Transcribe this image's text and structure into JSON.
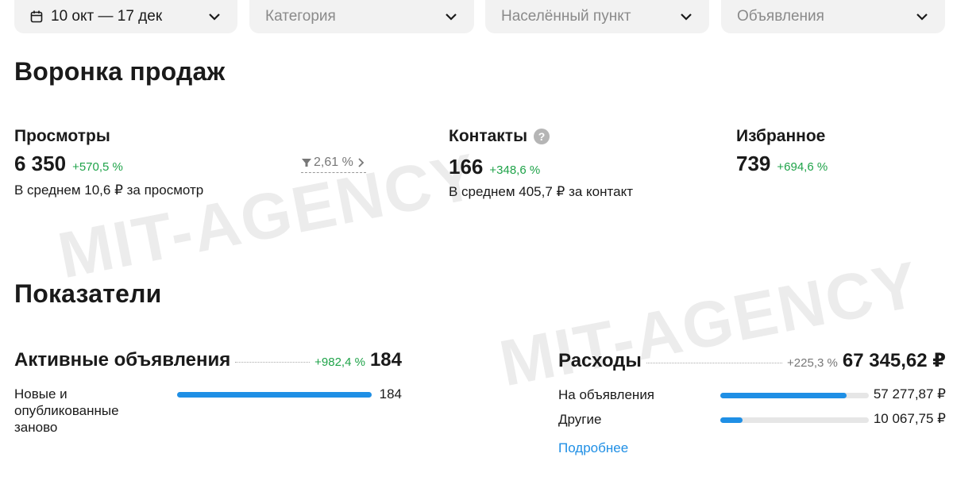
{
  "filters": {
    "period": "10 окт — 17 дек",
    "category": "Категория",
    "locality": "Населённый пункт",
    "ads": "Объявления"
  },
  "funnel": {
    "title": "Воронка продаж",
    "views": {
      "label": "Просмотры",
      "value": "6 350",
      "change": "+570,5 %",
      "sub": "В среднем 10,6 ₽ за просмотр",
      "conversion": "2,61 %"
    },
    "contacts": {
      "label": "Контакты",
      "help": "?",
      "value": "166",
      "change": "+348,6 %",
      "sub": "В среднем 405,7 ₽ за контакт"
    },
    "favorites": {
      "label": "Избранное",
      "value": "739",
      "change": "+694,6 %"
    }
  },
  "indicators": {
    "title": "Показатели",
    "active_ads": {
      "label": "Активные объявления",
      "change": "+982,4 %",
      "value": "184",
      "rows": [
        {
          "label": "Новые и опубликованные заново",
          "value": "184",
          "fraction": 1.0
        }
      ]
    },
    "expenses": {
      "label": "Расходы",
      "change": "+225,3 %",
      "value": "67 345,62 ₽",
      "rows": [
        {
          "label": "На объявления",
          "value": "57 277,87 ₽",
          "fraction": 0.85
        },
        {
          "label": "Другие",
          "value": "10 067,75 ₽",
          "fraction": 0.15
        }
      ],
      "more": "Подробнее"
    }
  },
  "watermark": "MIT-AGENCY",
  "colors": {
    "positive": "#1fa349",
    "neutral_change": "#777777",
    "accent": "#1f8fe5"
  }
}
